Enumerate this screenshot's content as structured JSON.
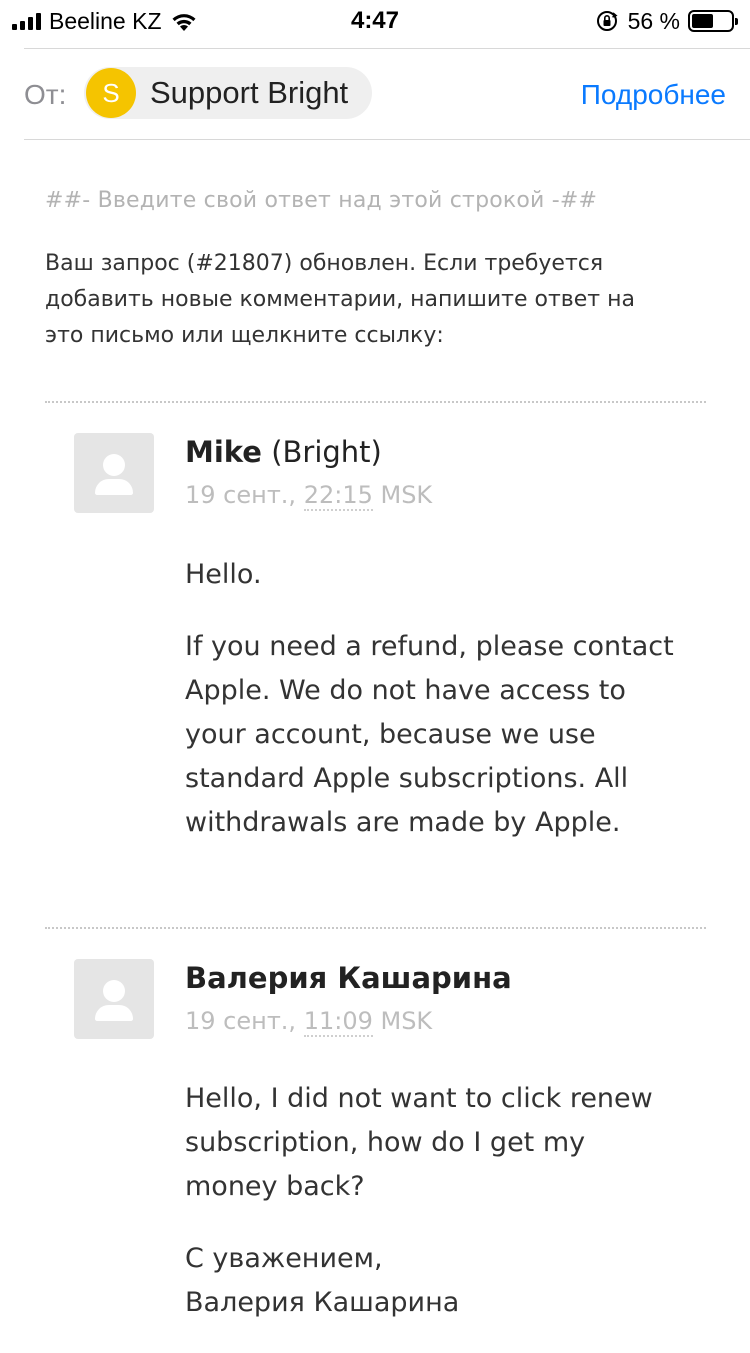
{
  "status_bar": {
    "carrier": "Beeline KZ",
    "time": "4:47",
    "battery_percent": "56 %",
    "battery_level": 0.56,
    "icons": [
      "signal-icon",
      "wifi-icon",
      "orientation-lock-icon",
      "battery-icon"
    ]
  },
  "header": {
    "from_label": "От:",
    "sender_initial": "S",
    "sender_name": "Support Bright",
    "details_link": "Подробнее",
    "sender_avatar_color": "#f5c400",
    "link_color": "#0a7aff"
  },
  "email": {
    "reply_line": "##- Введите свой ответ над этой строкой -##",
    "intro_lines": [
      "Ваш запрос (#21807) обновлен. Если требуется",
      "добавить новые комментарии, напишите ответ на",
      "это письмо или щелкните ссылку:"
    ],
    "comments": [
      {
        "author_name": "Mike",
        "author_suffix": " (Bright)",
        "date": "19 сент., ",
        "time": "22:15",
        "timezone": " MSK",
        "paragraphs": [
          [
            "Hello."
          ],
          [
            "If you need a refund, please contact",
            "Apple. We do not have access to",
            "your account, because we use",
            "standard Apple subscriptions. All",
            "withdrawals are made by Apple."
          ]
        ]
      },
      {
        "author_name": "Валерия Кашарина",
        "author_suffix": "",
        "date": "19 сент., ",
        "time": "11:09",
        "timezone": " MSK",
        "paragraphs": [
          [
            "Hello, I did not want to click renew",
            "subscription, how do I get my",
            "money back?"
          ],
          [
            "С уважением,",
            "Валерия Кашарина"
          ]
        ]
      }
    ]
  }
}
